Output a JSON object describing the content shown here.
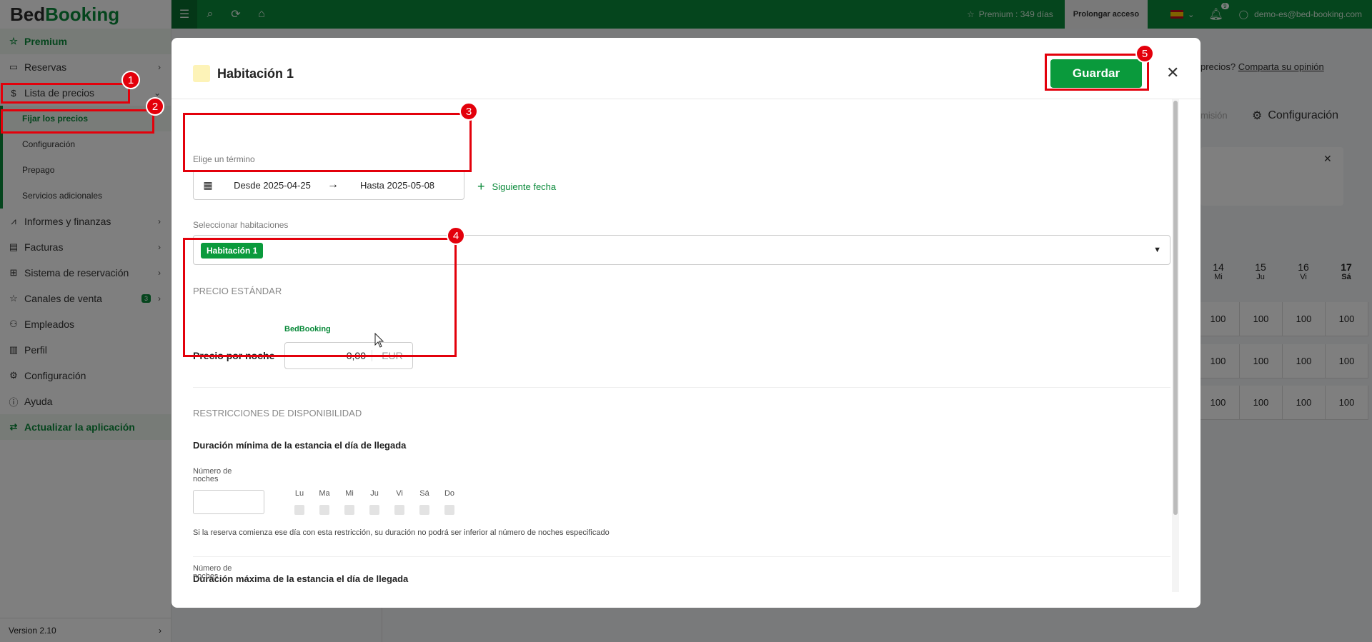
{
  "app": {
    "logo_a": "Bed",
    "logo_b": "Booking"
  },
  "sidebar": {
    "premium": "Premium",
    "items": [
      {
        "label": "Reservas"
      },
      {
        "label": "Lista de precios"
      },
      {
        "label": "Informes y finanzas"
      },
      {
        "label": "Facturas"
      },
      {
        "label": "Sistema de reservación"
      },
      {
        "label": "Canales de venta",
        "badge": "3"
      },
      {
        "label": "Empleados"
      },
      {
        "label": "Perfil"
      },
      {
        "label": "Configuración"
      },
      {
        "label": "Ayuda"
      }
    ],
    "subitems": [
      "Fijar los precios",
      "Configuración",
      "Prepago",
      "Servicios adicionales"
    ],
    "update": "Actualizar la aplicación",
    "version": "Version 2.10"
  },
  "topbar": {
    "premium_days": "Premium : 349 días",
    "prolong": "Prolongar acceso",
    "notif_count": "9",
    "email": "demo-es@bed-booking.com"
  },
  "background": {
    "opinion_text": "precios?",
    "opinion_link": "Comparta su opinión",
    "misc": "misión",
    "config": "Configuración",
    "days": [
      {
        "n": "14",
        "w": "Mi"
      },
      {
        "n": "15",
        "w": "Ju"
      },
      {
        "n": "16",
        "w": "Vi"
      },
      {
        "n": "17",
        "w": "Sá"
      }
    ],
    "cell_value": "100"
  },
  "modal": {
    "title": "Habitación 1",
    "save": "Guardar",
    "term_label": "Elige un término",
    "from": "Desde 2025-04-25",
    "to": "Hasta 2025-05-08",
    "next_date": "Siguiente fecha",
    "rooms_label": "Seleccionar habitaciones",
    "room_chip": "Habitación 1",
    "standard_price": "PRECIO ESTÁNDAR",
    "channel": "BedBooking",
    "price_per_night": "Precio por noche",
    "price_value": "0,00",
    "currency": "EUR",
    "restrictions": "RESTRICCIONES DE DISPONIBILIDAD",
    "min_stay": "Duración mínima de la estancia el día de llegada",
    "nights_label_1": "Número de",
    "nights_label_2": "noches",
    "weekdays": [
      "Lu",
      "Ma",
      "Mi",
      "Ju",
      "Vi",
      "Sá",
      "Do"
    ],
    "min_note": "Si la reserva comienza ese día con esta restricción, su duración no podrá ser inferior al número de noches especificado",
    "max_stay": "Duración máxima de la estancia el día de llegada"
  },
  "markers": [
    "1",
    "2",
    "3",
    "4",
    "5"
  ],
  "colors": {
    "brand": "#0a8a3a",
    "marker": "#e3000b"
  }
}
